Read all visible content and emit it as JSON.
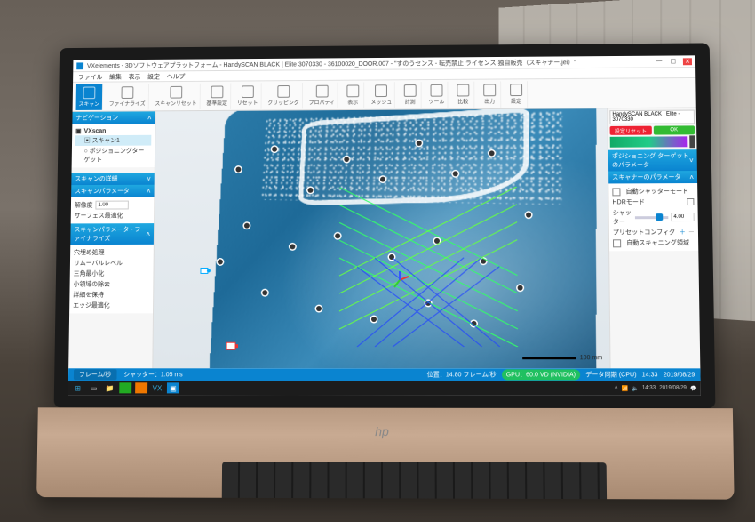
{
  "window": {
    "title": "VXelements - 3Dソフトウェアプラットフォーム - HandySCAN BLACK | Elite 3070330 - 36100020_DOOR.007 - \"すのうセンス - 転売禁止 ライセンス 独自販売（スキャナー.jei）\"",
    "min": "—",
    "max": "☐",
    "close": "✕"
  },
  "menu": [
    "ファイル",
    "編集",
    "表示",
    "設定",
    "ヘルプ"
  ],
  "ribbon": [
    {
      "label": "スキャン",
      "active": true
    },
    {
      "label": "ファイナライズ"
    },
    {
      "label": "スキャンリセット"
    },
    {
      "label": "基準設定"
    },
    {
      "label": "リセット"
    },
    {
      "label": "クリッピング"
    },
    {
      "label": "プロパティ"
    },
    {
      "label": "表示"
    },
    {
      "label": "メッシュ"
    },
    {
      "label": "計測"
    },
    {
      "label": "ツール"
    },
    {
      "label": "比較"
    },
    {
      "label": "出力"
    },
    {
      "label": "設定"
    }
  ],
  "nav": {
    "title": "ナビゲーション",
    "root": "VXscan",
    "items": [
      {
        "label": "スキャン1",
        "selected": true
      },
      {
        "label": "ポジショニングターゲット"
      }
    ]
  },
  "panels": {
    "scanDetails": {
      "title": "スキャンの詳細"
    },
    "scanParams": {
      "title": "スキャンパラメータ",
      "resolutionLabel": "解像度",
      "resolutionValue": "1.00",
      "surfaceLabel": "サーフェス最適化"
    },
    "finalize": {
      "title": "スキャンパラメータ - ファイナライズ",
      "rows": [
        "穴埋め処理",
        "リムーバルレベル",
        "三角最小化",
        "小領域の除去",
        "詳細を保持",
        "エッジ最適化"
      ]
    }
  },
  "rightPanel": {
    "device": "HandySCAN BLACK | Elite - 3070330",
    "btnConfig": "設定リセット",
    "btnCalib": "OK",
    "section1": "ポジショニング ターゲットのパラメータ",
    "section2": "スキャナーのパラメータ",
    "autoMode": "自動シャッターモード",
    "hdr": "HDRモード",
    "shutterLabel": "シャッター",
    "shutterValue": "4.00",
    "presetLabel": "プリセットコンフィグ",
    "autoScan": "自動スキャニング領域"
  },
  "viewport": {
    "scaleLabel": "100 mm"
  },
  "statusbar": {
    "frame": "フレーム/秒",
    "frameVal": "",
    "shutter": "シャッター：1.05 ms",
    "positioning": "位置：14.80 フレーム/秒",
    "gpu": "GPU：60.0 VD (NVIDIA)",
    "syncLabel": "データ同期 (CPU)",
    "time": "14:33",
    "date": "2019/08/29"
  },
  "taskbar": {
    "time": "14:33",
    "date": "2019/08/29"
  }
}
